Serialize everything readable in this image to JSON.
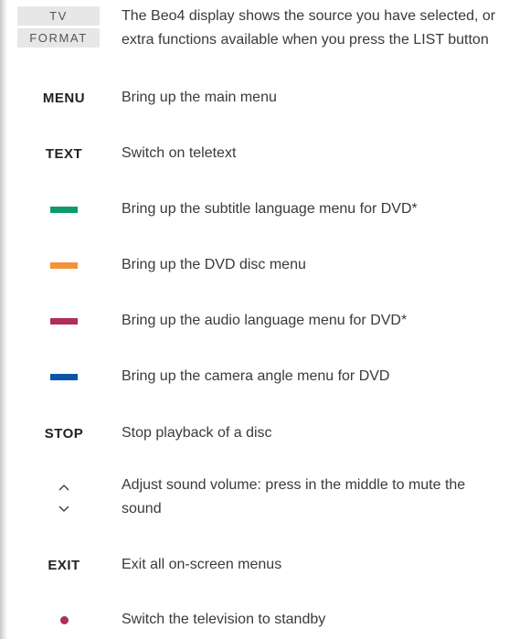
{
  "display": {
    "labels": [
      "TV",
      "FORMAT"
    ],
    "description": "The Beo4 display shows the source you have selected, or extra functions available when you press the LIST button"
  },
  "rows": [
    {
      "key": "MENU",
      "description": "Bring up the main menu"
    },
    {
      "key": "TEXT",
      "description": "Switch on teletext"
    },
    {
      "key_icon": "green-button-icon",
      "color": "#109a6b",
      "description": "Bring up the subtitle language menu for DVD*"
    },
    {
      "key_icon": "yellow-button-icon",
      "color": "#f39339",
      "description": "Bring up the DVD disc menu"
    },
    {
      "key_icon": "red-button-icon",
      "color": "#b02e59",
      "description": "Bring up the audio language menu for DVD*"
    },
    {
      "key_icon": "blue-button-icon",
      "color": "#0c54a6",
      "description": "Bring up the camera angle menu for DVD"
    },
    {
      "key": "STOP",
      "description": "Stop playback of a disc"
    },
    {
      "key_icon": "volume-up-down-icon",
      "description": "Adjust sound volume: press in the middle to mute the sound"
    },
    {
      "key": "EXIT",
      "description": "Exit all on-screen menus"
    },
    {
      "key_icon": "standby-button-icon",
      "color": "#b02e59",
      "description": "Switch the television to standby"
    }
  ]
}
